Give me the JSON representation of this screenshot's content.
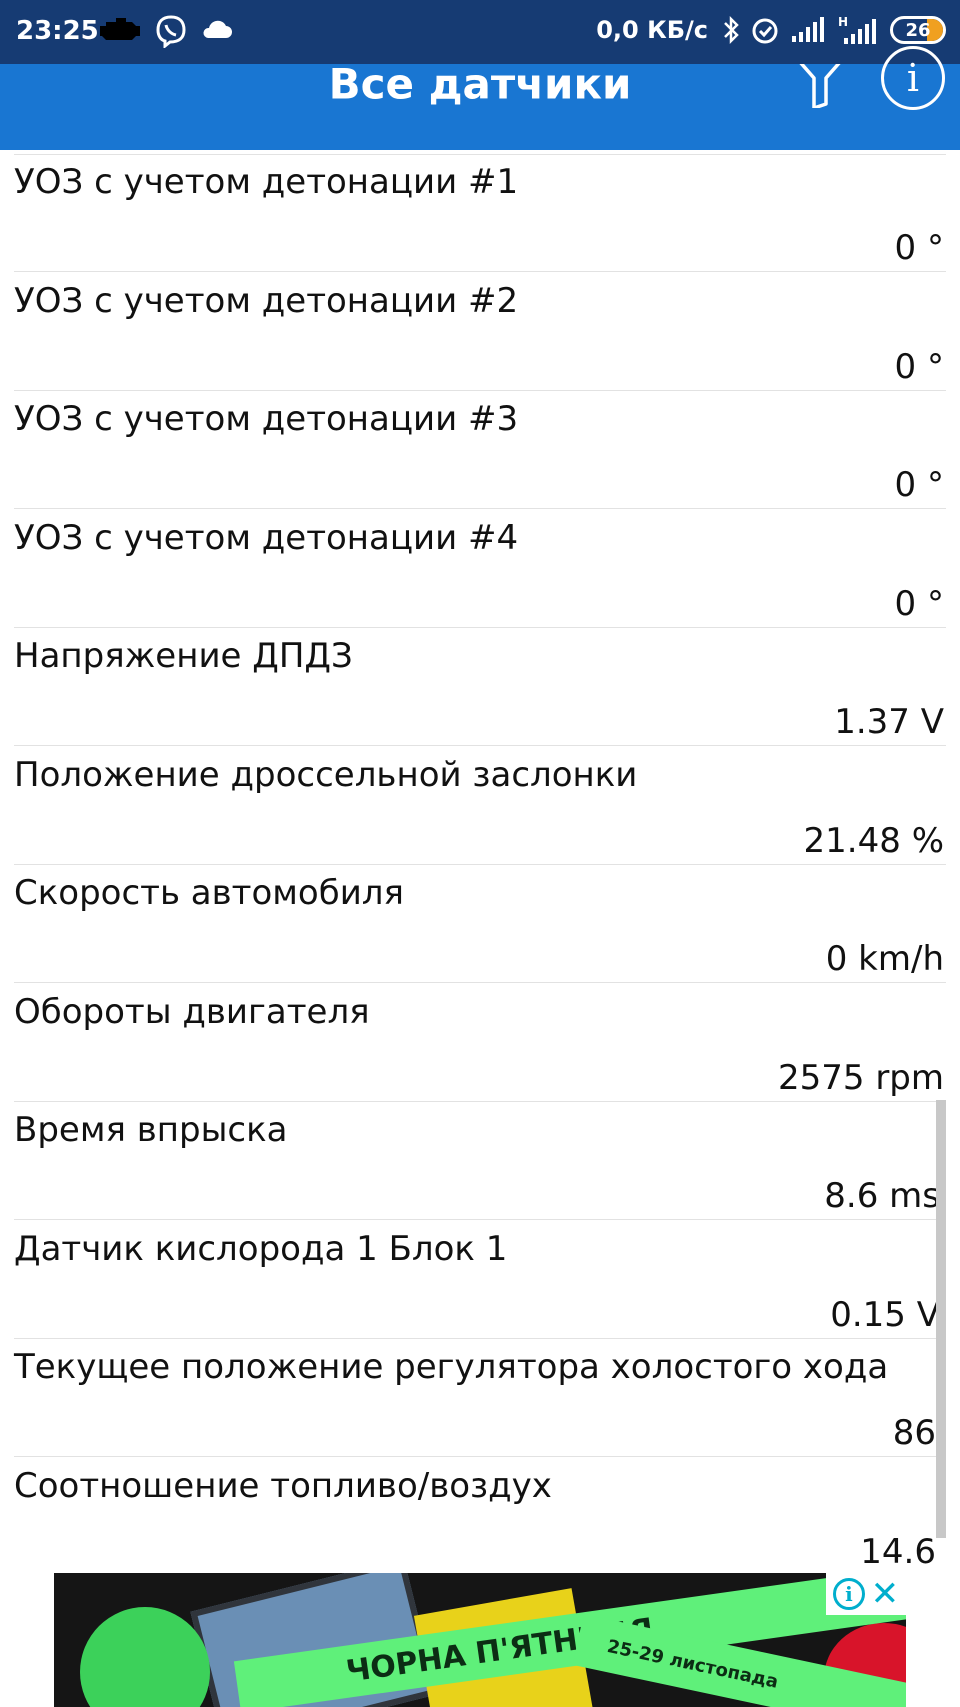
{
  "status_bar": {
    "time": "23:25",
    "speed": "0,0 КБ/с",
    "battery": "26",
    "icons": [
      "engine-icon",
      "viber-icon",
      "cloud-icon",
      "bluetooth-icon",
      "alarm-icon",
      "signal-icon",
      "signal-h-icon",
      "battery-icon"
    ]
  },
  "app_bar": {
    "title": "Все датчики",
    "icons": [
      "filter-icon",
      "info-icon"
    ],
    "color": "#1976d2"
  },
  "sensors": [
    {
      "label": "УОЗ с учетом детонации #1",
      "value": "0 °"
    },
    {
      "label": "УОЗ с учетом детонации #2",
      "value": "0 °"
    },
    {
      "label": "УОЗ с учетом детонации #3",
      "value": "0 °"
    },
    {
      "label": "УОЗ с учетом детонации #4",
      "value": "0 °"
    },
    {
      "label": "Напряжение ДПДЗ",
      "value": "1.37 V"
    },
    {
      "label": "Положение дроссельной заслонки",
      "value": "21.48 %"
    },
    {
      "label": "Скорость автомобиля",
      "value": "0 km/h"
    },
    {
      "label": "Обороты двигателя",
      "value": "2575 rpm"
    },
    {
      "label": "Время впрыска",
      "value": "8.6 ms"
    },
    {
      "label": "Датчик кислорода 1 Блок 1",
      "value": "0.15 V"
    },
    {
      "label": "Текущее положение регулятора холостого хода",
      "value": "86"
    },
    {
      "label": "Соотношение топливо/воздух",
      "value": "14.6"
    }
  ],
  "ad": {
    "text_main": "ЧОРНА П'ЯТНИЦЯ",
    "text_dates": "25-29 листопада",
    "icons": [
      "ad-info-icon",
      "ad-close-icon"
    ]
  }
}
